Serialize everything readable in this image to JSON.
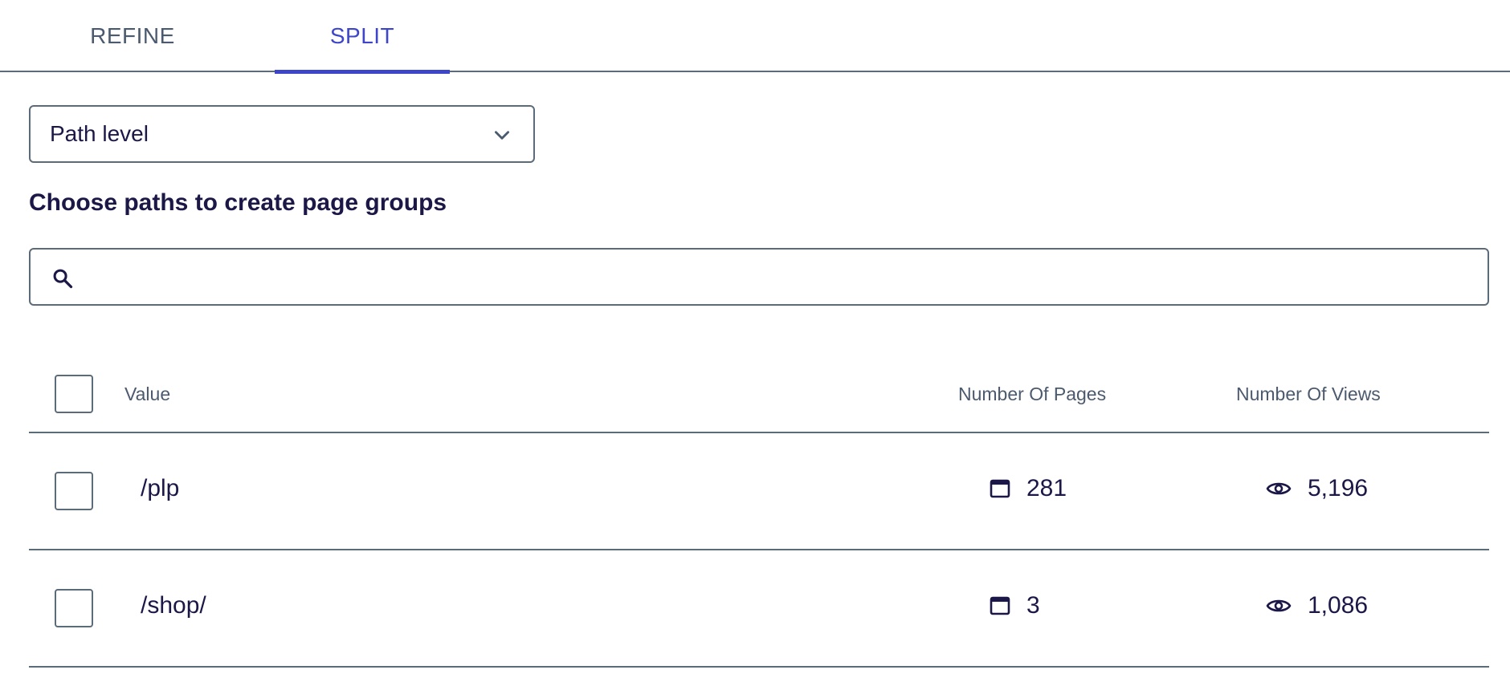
{
  "tabs": [
    {
      "label": "REFINE",
      "active": false
    },
    {
      "label": "SPLIT",
      "active": true
    }
  ],
  "colors": {
    "accent": "#3d45c9",
    "text": "#1b1747",
    "muted": "#4b5a6e",
    "border": "#5c6b7a"
  },
  "dropdown": {
    "selected": "Path level",
    "icon": "chevron-down-icon"
  },
  "section_title": "Choose paths to create page groups",
  "search": {
    "value": "",
    "placeholder": "",
    "icon": "search-icon"
  },
  "table": {
    "columns": [
      "Value",
      "Number Of Pages",
      "Number Of Views"
    ],
    "pages_icon": "window-icon",
    "views_icon": "eye-icon",
    "rows": [
      {
        "value": "/plp",
        "pages": "281",
        "views": "5,196"
      },
      {
        "value": "/shop/",
        "pages": "3",
        "views": "1,086"
      }
    ]
  }
}
